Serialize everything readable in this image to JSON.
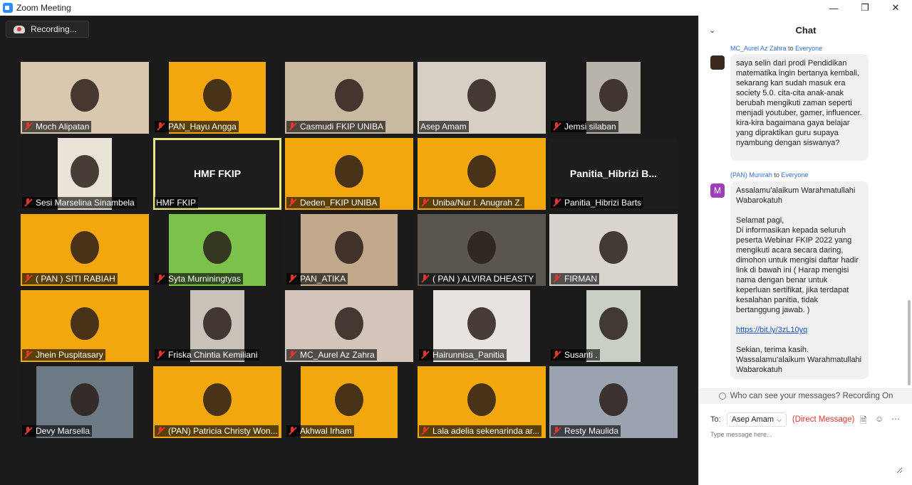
{
  "window": {
    "title": "Zoom Meeting",
    "min": "—",
    "max": "❐",
    "close": "✕"
  },
  "recording": {
    "label": "Recording..."
  },
  "participants": [
    {
      "name": "Moch Alipatan",
      "muted": true
    },
    {
      "name": "PAN_Hayu Angga",
      "muted": true
    },
    {
      "name": "Casmudi FKIP UNIBA",
      "muted": true
    },
    {
      "name": "Asep Amam",
      "muted": false
    },
    {
      "name": "Jemsi silaban",
      "muted": true
    },
    {
      "name": "Sesi Marselina Sinambela",
      "muted": true
    },
    {
      "name": "HMF FKIP",
      "muted": false,
      "display": "HMF FKIP"
    },
    {
      "name": "Deden_FKIP UNIBA",
      "muted": true
    },
    {
      "name": "Uniba/Nur I. Anugrah Z.",
      "muted": true
    },
    {
      "name": "Panitia_Hibrizi Barts",
      "muted": true,
      "display": "Panitia_Hibrizi  B..."
    },
    {
      "name": "( PAN ) SITI RABIAH",
      "muted": true
    },
    {
      "name": "Syta Murniningtyas",
      "muted": true
    },
    {
      "name": "PAN_ATIKA",
      "muted": true
    },
    {
      "name": "( PAN ) ALVIRA DHEASTY",
      "muted": true
    },
    {
      "name": "FIRMAN",
      "muted": true
    },
    {
      "name": "Jhein Puspitasary",
      "muted": true
    },
    {
      "name": "Friska Chintia Kemiliani",
      "muted": true
    },
    {
      "name": "MC_Aurel Az Zahra",
      "muted": true
    },
    {
      "name": "Hairunnisa_Panitia",
      "muted": true
    },
    {
      "name": "Susanti .",
      "muted": true
    },
    {
      "name": "Devy Marsella",
      "muted": true
    },
    {
      "name": "(PAN) Patricia Christy Won...",
      "muted": true
    },
    {
      "name": "Akhwal Irham",
      "muted": true
    },
    {
      "name": "Lala adelia sekenarinda ar...",
      "muted": true
    },
    {
      "name": "Resty Maulida",
      "muted": true
    }
  ],
  "chat": {
    "title": "Chat",
    "messages": [
      {
        "sender": "MC_Aurel Az Zahra",
        "to_word": "to",
        "recipient": "Everyone",
        "text": "saya selin dari prodi Pendidikan matematika ingin bertanya kembali, sekarang kan sudah masuk era society 5.0. cita-cita anak-anak berubah mengikuti zaman seperti menjadi youtuber, gamer, influencer. kira-kira bagaimana gaya belajar yang dipraktikan guru supaya nyambung dengan siswanya?"
      },
      {
        "sender": "(PAN) Munirah",
        "to_word": "to",
        "recipient": "Everyone",
        "avatar_letter": "M",
        "text": "Assalamu'alaikum Warahmatullahi Wabarokatuh\n\nSelamat pagi,\nDi informasikan kepada seluruh peserta Webinar FKIP 2022 yang mengikuti acara secara daring, dimohon untuk mengisi daftar hadir link di bawah ini ( Harap mengisi nama dengan benar untuk keperluan sertifikat, jika terdapat kesalahan panitia, tidak bertanggung jawab. )",
        "link": "https://bit.ly/3zL10yq",
        "closing": "Sekian, terima kasih.\nWassalamu'alaikum Warahmatullahi Wabarokatuh"
      }
    ],
    "notice": "Who can see your messages? Recording On",
    "to_label": "To:",
    "to_value": "Asep Amam",
    "direct_message": "(Direct Message)",
    "input_placeholder": "Type message here..."
  },
  "colors": {
    "accent": "#2d8cff",
    "muted_mic": "#e0372f",
    "active_speaker": "#e8e880",
    "stage_bg": "#1b1b1b",
    "webinar_orange": "#f2a70f"
  }
}
